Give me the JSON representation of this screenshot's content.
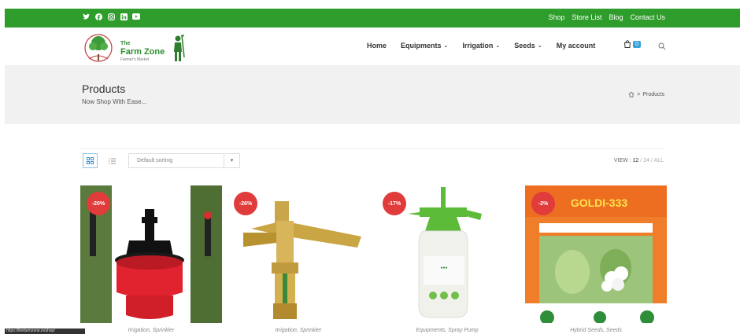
{
  "topbar": {
    "social_icons": [
      "twitter-icon",
      "facebook-icon",
      "instagram-icon",
      "linkedin-icon",
      "youtube-icon"
    ],
    "links": [
      "Shop",
      "Store List",
      "Blog",
      "Contact Us"
    ],
    "bg_color": "#2f9d2c"
  },
  "logo": {
    "line1": "The",
    "line2": "Farm Zone",
    "line3": "Farmer's Market"
  },
  "nav": {
    "home": "Home",
    "equipments": "Equipments",
    "irrigation": "Irrigation",
    "seeds": "Seeds",
    "my_account": "My account",
    "cart_count": "0"
  },
  "page_header": {
    "title": "Products",
    "subtitle": "Now Shop With Ease...",
    "breadcrumb_sep": ">",
    "breadcrumb_current": "Products"
  },
  "toolbar": {
    "sort_value": "Default sorting",
    "view_label": "VIEW :",
    "view_12": "12",
    "sep1": "/",
    "view_24": "24",
    "sep2": "/",
    "view_all": "ALL"
  },
  "products": [
    {
      "badge": "-20%",
      "category": "Irrigation, Sprinkler"
    },
    {
      "badge": "-26%",
      "category": "Irrigation, Sprinkler"
    },
    {
      "badge": "-17%",
      "category": "Equipments, Spray Pump"
    },
    {
      "badge": "-2%",
      "category": "Hybrid Seeds, Seeds",
      "image_title": "GOLDI-333"
    }
  ],
  "statusbar": "https://thefarmzone.in/shop/"
}
